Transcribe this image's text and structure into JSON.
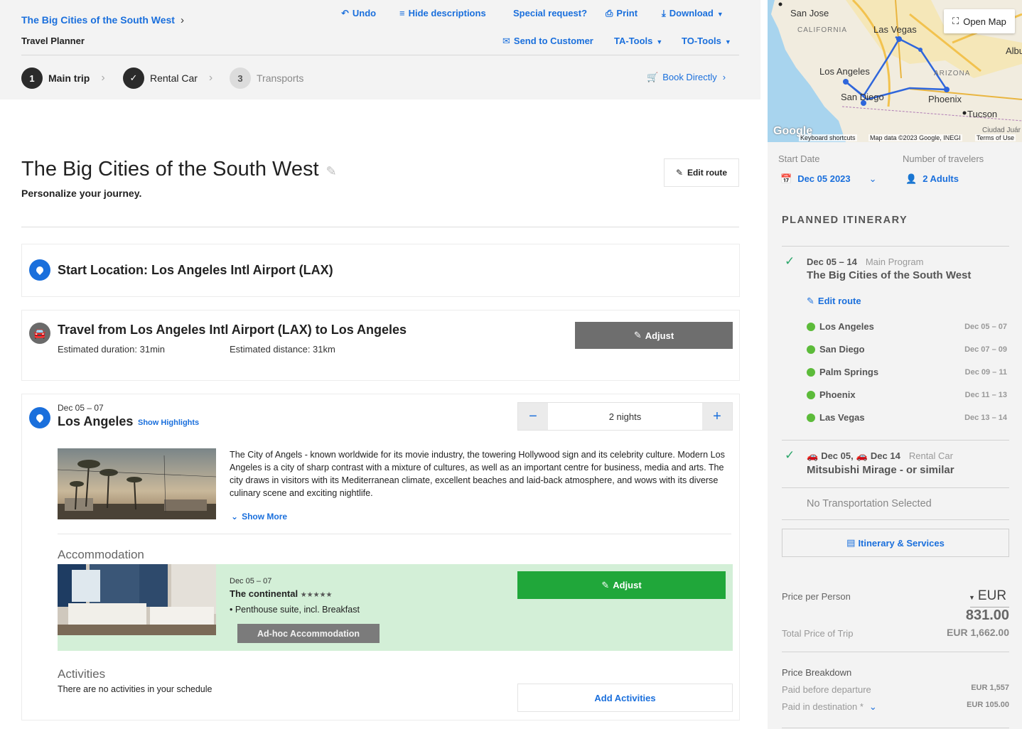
{
  "breadcrumb": {
    "label": "The Big Cities of the South West"
  },
  "app_subtitle": "Travel Planner",
  "toolbar": {
    "undo": "Undo",
    "hide_descriptions": "Hide descriptions",
    "special_request": "Special request?",
    "print": "Print",
    "download": "Download",
    "send_to_customer": "Send to Customer",
    "ta_tools": "TA-Tools",
    "to_tools": "TO-Tools"
  },
  "steps": [
    {
      "number": "1",
      "label": "Main trip"
    },
    {
      "number": "",
      "label": "Rental Car"
    },
    {
      "number": "3",
      "label": "Transports"
    }
  ],
  "book_directly": "Book Directly",
  "trip": {
    "title": "The Big Cities of the South West",
    "subtitle": "Personalize your journey.",
    "edit_route": "Edit route"
  },
  "start_location": "Start Location: Los Angeles Intl Airport (LAX)",
  "travel": {
    "title": "Travel from Los Angeles Intl Airport (LAX) to Los Angeles",
    "duration": "Estimated duration: 31min",
    "distance": "Estimated distance: 31km",
    "adjust": "Adjust"
  },
  "stop": {
    "dates": "Dec 05 – 07",
    "city": "Los Angeles",
    "show_highlights": "Show Highlights",
    "nights": "2 nights",
    "description": "The City of Angels - known worldwide for its movie industry, the towering Hollywood sign and its celebrity culture. Modern Los Angeles is a city of sharp contrast with a mixture of cultures, as well as an important centre for business, media and arts. The city draws in visitors with its Mediterranean climate, excellent beaches and laid-back atmosphere, and wows with its diverse culinary scene and exciting nightlife.",
    "show_more": "Show More",
    "accommodation_label": "Accommodation",
    "hotel": {
      "dates": "Dec 05 – 07",
      "name": "The continental",
      "stars": "★★★★★",
      "room": "• Penthouse suite, incl. Breakfast",
      "adhoc": "Ad-hoc Accommodation",
      "adjust": "Adjust"
    },
    "activities_label": "Activities",
    "no_activities": "There are no activities in your schedule",
    "add_activities": "Add Activities"
  },
  "map": {
    "open_map": "Open Map",
    "labels": [
      "San Jose",
      "CALIFORNIA",
      "Las Vegas",
      "Albu",
      "Los Angeles",
      "ARIZONA",
      "San Diego",
      "Phoenix",
      "Tucson",
      "Ciudad Juár"
    ],
    "google": "Google",
    "footer": {
      "shortcuts": "Keyboard shortcuts",
      "data": "Map data ©2023 Google, INEGI",
      "terms": "Terms of Use"
    }
  },
  "sidebar": {
    "start_date_label": "Start Date",
    "start_date": "Dec 05 2023",
    "travelers_label": "Number of travelers",
    "travelers": "2 Adults",
    "planned_itinerary": "PLANNED ITINERARY",
    "main": {
      "dates": "Dec 05 – 14",
      "tag": "Main Program",
      "title": "The Big Cities of the South West",
      "edit_route": "Edit route"
    },
    "stops": [
      {
        "city": "Los Angeles",
        "dates": "Dec 05 – 07"
      },
      {
        "city": "San Diego",
        "dates": "Dec 07 – 09"
      },
      {
        "city": "Palm Springs",
        "dates": "Dec 09 – 11"
      },
      {
        "city": "Phoenix",
        "dates": "Dec 11 – 13"
      },
      {
        "city": "Las Vegas",
        "dates": "Dec 13 – 14"
      }
    ],
    "rental": {
      "from": "Dec 05,",
      "to": "Dec 14",
      "tag": "Rental Car",
      "title": "Mitsubishi Mirage - or similar"
    },
    "no_transport": "No Transportation Selected",
    "itinerary_services": "Itinerary & Services",
    "price_per_person_label": "Price per Person",
    "currency": "EUR",
    "price_per_person": "831.00",
    "total_label": "Total Price of Trip",
    "total": "EUR 1,662.00",
    "breakdown_label": "Price Breakdown",
    "paid_before_label": "Paid before departure",
    "paid_before": "EUR 1,557",
    "paid_dest_label": "Paid in destination *",
    "paid_dest": "EUR 105.00"
  }
}
